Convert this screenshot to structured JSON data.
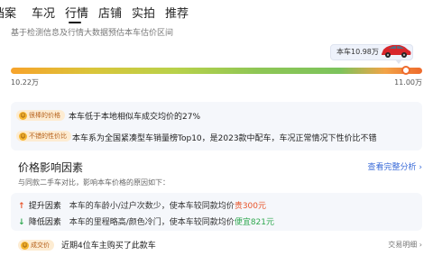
{
  "tabs": [
    {
      "label": "档案"
    },
    {
      "label": "车况"
    },
    {
      "label": "行情"
    },
    {
      "label": "店铺"
    },
    {
      "label": "实拍"
    },
    {
      "label": "推荐"
    }
  ],
  "subtitle": "基于检测信息及行情大数据预估本车估价区间",
  "price_bubble": {
    "label": "本车10.98万"
  },
  "price_range": {
    "low": "10.22万",
    "high": "11.00万",
    "current_position_fraction": 0.96
  },
  "insights": [
    {
      "badge": "很棒的价格",
      "text": "本车低于本地相似车成交均价的27%"
    },
    {
      "badge": "不错的性价比",
      "text": "本车系为全国紧凑型车销量榜Top10，是2023款中配车，车况正常情况下性价比不错"
    }
  ],
  "price_factors": {
    "title": "价格影响因素",
    "link": "查看完整分析",
    "desc": "与同款二手车对比，影响本车价格的原因如下：",
    "rows": [
      {
        "icon": "↑",
        "name": "提升因素",
        "desc": "本车的车龄小/过户次数少，使本车较同款均价",
        "delta": "贵300元"
      },
      {
        "icon": "↓",
        "name": "降低因素",
        "desc": "本车的里程略高/颜色冷门，使本车较同款均价",
        "delta": "便宜821元"
      }
    ]
  },
  "deal": {
    "badge": "成交价",
    "text": "近期4位车主购买了此款车",
    "link": "交易明细"
  },
  "colors": {
    "up": "#e8542a",
    "down": "#2fa84f",
    "link": "#3a6bd8",
    "accent": "#ee6a2c"
  }
}
